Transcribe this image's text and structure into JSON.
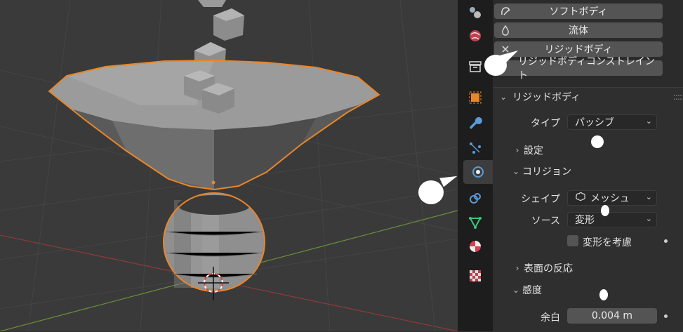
{
  "physics_buttons": {
    "soft_body": "ソフトボディ",
    "fluid": "流体",
    "rigid_body": "リジッドボディ",
    "rigid_body_constraint": "リジッドボディコンストレイント"
  },
  "rigid_body_panel": {
    "title": "リジッドボディ",
    "type_label": "タイプ",
    "type_value": "パッシブ",
    "settings_label": "設定",
    "collision_label": "コリジョン",
    "shape_label": "シェイプ",
    "shape_value": "メッシュ",
    "source_label": "ソース",
    "source_value": "変形",
    "deform_checkbox_label": "変形を考慮",
    "deform_checked": false,
    "surface_response_label": "表面の反応",
    "sensitivity_label": "感度",
    "margin_label": "余白",
    "margin_value": "0.004 m"
  },
  "tabs": [
    "tool-tab",
    "render-tab",
    "world-tab",
    "object-tab",
    "modifier-tab",
    "particles-tab",
    "physics-tab",
    "constraints-tab",
    "data-tab",
    "material-tab",
    "texture-tab"
  ],
  "colors": {
    "viewport_bg": "#3a3a3a",
    "panel_bg": "#2b2b2b",
    "button_bg": "#545454",
    "selection_outline": "#e8862a",
    "x_axis": "#8a3a3a",
    "y_axis": "#6a8a3a"
  }
}
